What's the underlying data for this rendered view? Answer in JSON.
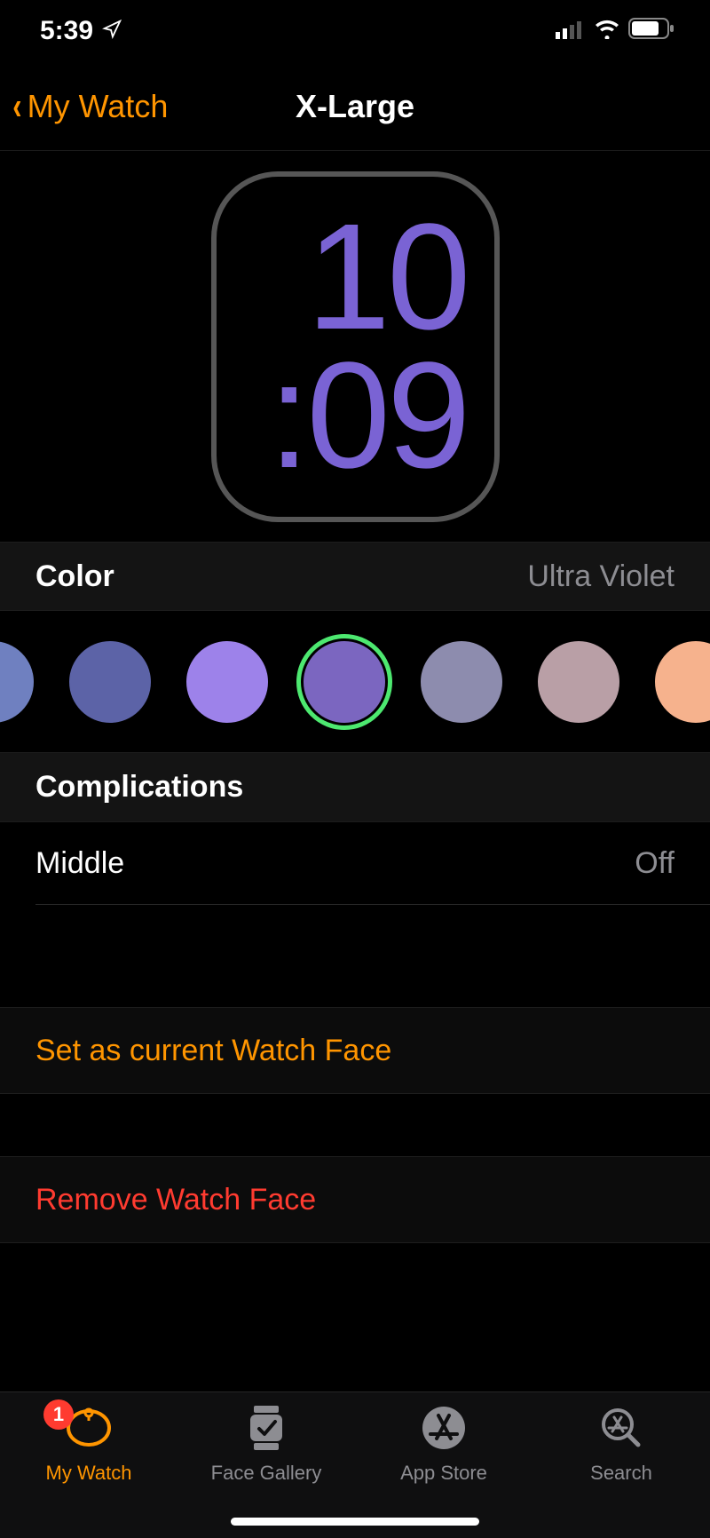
{
  "statusBar": {
    "time": "5:39"
  },
  "nav": {
    "back": "My Watch",
    "title": "X-Large"
  },
  "watchFace": {
    "timeTop": "10",
    "timeBottom": ":09",
    "colorHex": "#7a63d4"
  },
  "color": {
    "label": "Color",
    "value": "Ultra Violet",
    "swatches": [
      {
        "hex": "#6f80c0"
      },
      {
        "hex": "#5c63a7"
      },
      {
        "hex": "#9d82ea"
      },
      {
        "hex": "#7b66c0",
        "selected": true
      },
      {
        "hex": "#8d8cae"
      },
      {
        "hex": "#b99fa6"
      },
      {
        "hex": "#f6b28d"
      }
    ]
  },
  "complications": {
    "header": "Complications",
    "middle": {
      "label": "Middle",
      "value": "Off"
    }
  },
  "actions": {
    "set": "Set as current Watch Face",
    "remove": "Remove Watch Face"
  },
  "tabs": {
    "myWatch": {
      "label": "My Watch",
      "badge": "1"
    },
    "faceGallery": {
      "label": "Face Gallery"
    },
    "appStore": {
      "label": "App Store"
    },
    "search": {
      "label": "Search"
    }
  }
}
